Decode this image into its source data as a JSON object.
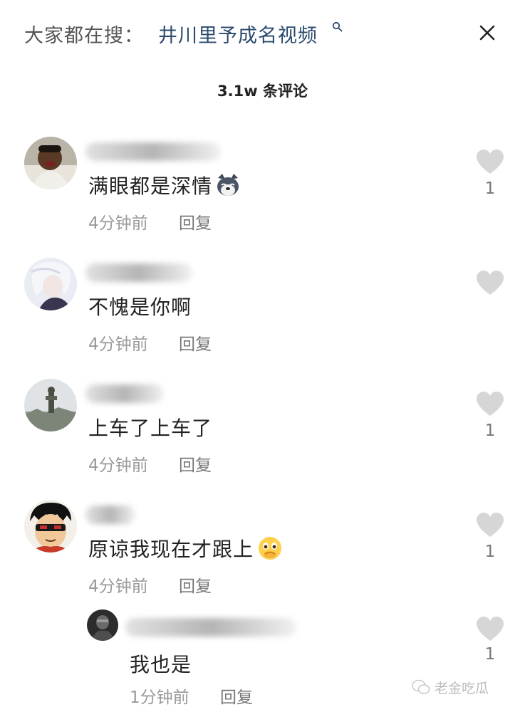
{
  "header": {
    "search_prefix": "大家都在搜：",
    "search_term": "井川里予成名视频",
    "search_icon": "search-icon",
    "close_icon": "close-icon"
  },
  "comment_count": "3.1w 条评论",
  "comments": [
    {
      "text": "满眼都是深情",
      "time": "4分钟前",
      "reply": "回复",
      "likes": "1",
      "emoji": "husky-emoji"
    },
    {
      "text": "不愧是你啊",
      "time": "4分钟前",
      "reply": "回复",
      "likes": ""
    },
    {
      "text": "上车了上车了",
      "time": "4分钟前",
      "reply": "回复",
      "likes": "1"
    },
    {
      "text": "原谅我现在才跟上",
      "time": "4分钟前",
      "reply": "回复",
      "likes": "1",
      "emoji": "pleading-face-emoji"
    },
    {
      "text": "我也是",
      "time": "1分钟前",
      "reply": "回复",
      "likes": "1"
    }
  ],
  "watermark": "老金吃瓜",
  "colors": {
    "like_gray": "#d6d6d6",
    "search_term": "#2b4a6e",
    "meta_gray": "#9a9a9a"
  }
}
